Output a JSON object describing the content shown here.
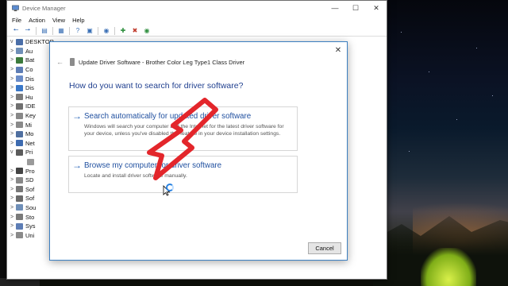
{
  "device_manager": {
    "title": "Device Manager",
    "menu": [
      "File",
      "Action",
      "View",
      "Help"
    ],
    "tree": [
      {
        "label": "DESKTOP",
        "caret": "v",
        "color": "#4a6ea8"
      },
      {
        "label": "Au",
        "caret": ">",
        "color": "#6f8fb8"
      },
      {
        "label": "Bat",
        "caret": ">",
        "color": "#3b7a3b"
      },
      {
        "label": "Co",
        "caret": ">",
        "color": "#5d7db5"
      },
      {
        "label": "Dis",
        "caret": ">",
        "color": "#6a8cc8"
      },
      {
        "label": "Dis",
        "caret": ">",
        "color": "#3a78c8"
      },
      {
        "label": "Hu",
        "caret": ">",
        "color": "#7a7a7a"
      },
      {
        "label": "IDE",
        "caret": ">",
        "color": "#6f6f6f"
      },
      {
        "label": "Key",
        "caret": ">",
        "color": "#888888"
      },
      {
        "label": "Mi",
        "caret": ">",
        "color": "#8a8a8a"
      },
      {
        "label": "Mo",
        "caret": ">",
        "color": "#4f6fa0"
      },
      {
        "label": "Net",
        "caret": ">",
        "color": "#3d6bb0"
      },
      {
        "label": "Pri",
        "caret": "v",
        "color": "#5b5b5b"
      },
      {
        "label": "",
        "caret": "",
        "color": "#9a9a9a"
      },
      {
        "label": "Pro",
        "caret": ">",
        "color": "#444444"
      },
      {
        "label": "SD",
        "caret": ">",
        "color": "#888888"
      },
      {
        "label": "Sof",
        "caret": ">",
        "color": "#777777"
      },
      {
        "label": "Sof",
        "caret": ">",
        "color": "#6a6a6a"
      },
      {
        "label": "Sou",
        "caret": ">",
        "color": "#6f8fb8"
      },
      {
        "label": "Sto",
        "caret": ">",
        "color": "#7a7a7a"
      },
      {
        "label": "Sys",
        "caret": ">",
        "color": "#5d7db5"
      },
      {
        "label": "Uni",
        "caret": ">",
        "color": "#8a8a8a"
      }
    ]
  },
  "wizard": {
    "header": "Update Driver Software - Brother Color Leg Type1 Class Driver",
    "back_icon": "←",
    "close_icon": "✕",
    "question": "How do you want to search for driver software?",
    "option_auto": {
      "title": "Search automatically for updated driver software",
      "description": "Windows will search your computer and the Internet for the latest driver software for your device, unless you've disabled this feature in your device installation settings."
    },
    "option_browse": {
      "title": "Browse my computer for driver software",
      "description": "Locate and install driver software manually."
    },
    "option_arrow": "→",
    "cancel_label": "Cancel"
  },
  "colors": {
    "annotation_arrow": "#e3262b",
    "link_blue": "#1f4f9f"
  }
}
